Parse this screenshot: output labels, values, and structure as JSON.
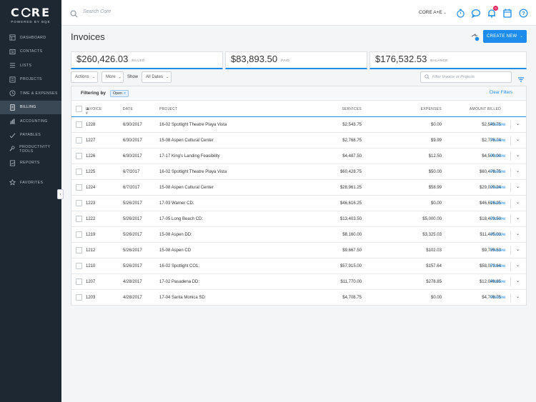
{
  "brand": {
    "name_left": "C",
    "name_right": "RE",
    "tagline": "POWERED BY BQE"
  },
  "sidebar": {
    "items": [
      {
        "label": "Dashboard",
        "icon": "dashboard-icon"
      },
      {
        "label": "Contacts",
        "icon": "contacts-icon"
      },
      {
        "label": "Lists",
        "icon": "lists-icon"
      },
      {
        "label": "Projects",
        "icon": "projects-icon"
      },
      {
        "label": "Time & Expenses",
        "icon": "clock-icon"
      },
      {
        "label": "Billing",
        "icon": "billing-icon",
        "active": true
      },
      {
        "label": "Accounting",
        "icon": "accounting-icon"
      },
      {
        "label": "Payables",
        "icon": "payables-icon"
      },
      {
        "label": "Productivity Tools",
        "icon": "wrench-icon"
      },
      {
        "label": "Reports",
        "icon": "reports-icon"
      }
    ],
    "favorites": {
      "label": "Favorites",
      "icon": "star-icon"
    }
  },
  "topbar": {
    "search_placeholder": "Search Core",
    "company": "CORE A+E",
    "notification_count": "0"
  },
  "header": {
    "title": "Invoices",
    "create_label": "CREATE NEW"
  },
  "stats": [
    {
      "value": "$260,426.03",
      "label": "BILLED"
    },
    {
      "value": "$83,893.50",
      "label": "PAID"
    },
    {
      "value": "$176,532.53",
      "label": "BALANCE"
    }
  ],
  "toolbar": {
    "actions": "Actions",
    "more": "More",
    "show": "Show",
    "dates": "All Dates",
    "filter_placeholder": "Filter Invoice or Projects"
  },
  "filter": {
    "label": "Filtering by",
    "chip": "Open",
    "clear": "Clear Filters"
  },
  "table": {
    "columns": {
      "invoice": "Invoice #",
      "date": "Date",
      "project": "Project",
      "services": "Services",
      "expenses": "Expenses",
      "amount": "Amount Billed"
    },
    "preview_label": "Preview",
    "rows": [
      {
        "invoice": "1228",
        "date": "6/30/2017",
        "project": "16-02 Spotlight Theatre Playa Vista",
        "services": "$2,543.75",
        "expenses": "$0.00",
        "amount": "$2,543.75"
      },
      {
        "invoice": "1227",
        "date": "6/30/2017",
        "project": "15-08 Aspen Cultural Center",
        "services": "$2,768.75",
        "expenses": "$9.99",
        "amount": "$2,778.74"
      },
      {
        "invoice": "1226",
        "date": "6/30/2017",
        "project": "17-17 King's Landing Feasibility",
        "services": "$4,487.50",
        "expenses": "$12.50",
        "amount": "$4,500.00"
      },
      {
        "invoice": "1225",
        "date": "6/7/2017",
        "project": "16-02 Spotlight Theatre Playa Vista",
        "services": "$60,428.75",
        "expenses": "$50.00",
        "amount": "$60,478.75"
      },
      {
        "invoice": "1224",
        "date": "6/7/2017",
        "project": "15-08 Aspen Cultural Center",
        "services": "$28,961.25",
        "expenses": "$58.99",
        "amount": "$29,020.24"
      },
      {
        "invoice": "1223",
        "date": "5/26/2017",
        "project": "17-03 Warner CD:",
        "services": "$46,616.25",
        "expenses": "$0.00",
        "amount": "$46,616.25"
      },
      {
        "invoice": "1222",
        "date": "5/26/2017",
        "project": "17-05 Long Beach CD:",
        "services": "$13,403.50",
        "expenses": "$5,000.00",
        "amount": "$18,403.50"
      },
      {
        "invoice": "1219",
        "date": "5/26/2017",
        "project": "15-08 Aspen DD:",
        "services": "$8,160.00",
        "expenses": "$3,325.03",
        "amount": "$11,485.03"
      },
      {
        "invoice": "1212",
        "date": "5/26/2017",
        "project": "15-08 Aspen CD",
        "services": "$9,667.50",
        "expenses": "$102.03",
        "amount": "$9,769.53"
      },
      {
        "invoice": "1210",
        "date": "5/26/2017",
        "project": "16-02 Spotlight CO1:",
        "services": "$57,915.00",
        "expenses": "$157.64",
        "amount": "$58,072.64"
      },
      {
        "invoice": "1207",
        "date": "4/28/2017",
        "project": "17-02 Pasadena DD:",
        "services": "$11,770.00",
        "expenses": "$278.85",
        "amount": "$12,048.85"
      },
      {
        "invoice": "1203",
        "date": "4/28/2017",
        "project": "17-04 Santa Monica SD:",
        "services": "$4,708.75",
        "expenses": "$0.00",
        "amount": "$4,708.75"
      }
    ]
  },
  "colors": {
    "accent": "#1d8cec",
    "sidebar": "#1e2833",
    "badge": "#e0245e"
  }
}
